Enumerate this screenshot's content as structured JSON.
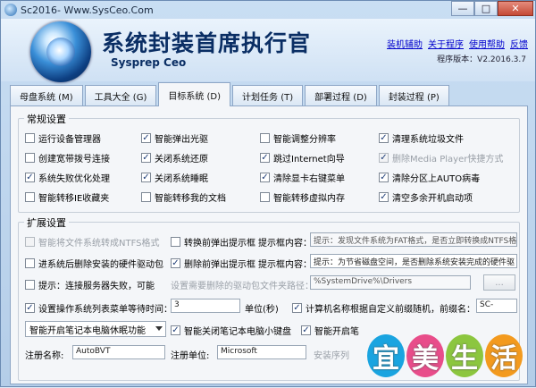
{
  "window": {
    "title": "Sc2016- Www.SysCeo.Com",
    "min": "—",
    "max": "□",
    "close": "✕"
  },
  "header": {
    "name": "系统封装首席执行官",
    "subtitle": "Sysprep Ceo",
    "links": [
      "装机辅助",
      "关于程序",
      "使用帮助",
      "反馈"
    ],
    "version": "程序版本：V2.2016.3.7"
  },
  "tabs": [
    {
      "label": "母盘系统 (M)"
    },
    {
      "label": "工具大全 (G)"
    },
    {
      "label": "目标系统 (D)"
    },
    {
      "label": "计划任务 (T)"
    },
    {
      "label": "部署过程 (D)"
    },
    {
      "label": "封装过程 (P)"
    }
  ],
  "active_tab": "目标系统 (D)",
  "general": {
    "title": "常规设置",
    "items": [
      {
        "label": "运行设备管理器",
        "checked": false
      },
      {
        "label": "智能弹出光驱",
        "checked": true
      },
      {
        "label": "智能调整分辨率",
        "checked": false
      },
      {
        "label": "清理系统垃圾文件",
        "checked": true
      },
      {
        "label": "创建宽带拨号连接",
        "checked": false
      },
      {
        "label": "关闭系统还原",
        "checked": true
      },
      {
        "label": "跳过Internet向导",
        "checked": true
      },
      {
        "label": "删除Media Player快捷方式",
        "checked": true,
        "disabled": true
      },
      {
        "label": "系统失败优化处理",
        "checked": true
      },
      {
        "label": "关闭系统睡眠",
        "checked": true
      },
      {
        "label": "清除显卡右键菜单",
        "checked": true
      },
      {
        "label": "清除分区上AUTO病毒",
        "checked": true
      },
      {
        "label": "智能转移IE收藏夹",
        "checked": false
      },
      {
        "label": "智能转移我的文档",
        "checked": false
      },
      {
        "label": "智能转移虚拟内存",
        "checked": false
      },
      {
        "label": "清空多余开机启动项",
        "checked": true
      }
    ]
  },
  "extended": {
    "title": "扩展设置",
    "ntfs": {
      "label": "智能将文件系统转成NTFS格式",
      "checked": false
    },
    "prompt1": {
      "label": "转换前弹出提示框",
      "checked": false
    },
    "prompt1_content_label": "提示框内容：",
    "prompt1_content": "提示：发现文件系统为FAT格式，是否立即转换成NTFS格",
    "remove_drivers": {
      "label": "进系统后删除安装的硬件驱动包",
      "checked": false
    },
    "prompt2": {
      "label": "删除前弹出提示框",
      "checked": true
    },
    "prompt2_content_label": "提示框内容：",
    "prompt2_content": "提示：为节省磁盘空间，是否删除系统安装完成的硬件驱",
    "server_fail": {
      "label": "提示：连接服务器失败，可能",
      "checked": false
    },
    "driver_path_label": "设置需要删除的驱动包文件夹路径：",
    "driver_path": "%SystemDrive%\\Drivers",
    "browse": "...",
    "wait": {
      "label": "设置操作系统列表菜单等待时间：",
      "checked": true
    },
    "wait_value": "3",
    "wait_unit": "单位(秒)",
    "computer_name": {
      "label": "计算机名称根据自定义前缀随机，前缀名：",
      "checked": true
    },
    "prefix_value": "SC-",
    "power_select": "智能开启笔记本电脑休眠功能",
    "close_keyboard": {
      "label": "智能关闭笔记本电脑小键盘",
      "checked": true
    },
    "open_kb": {
      "label": "智能开启笔",
      "checked": true
    },
    "reg_name_label": "注册名称:",
    "reg_name": "AutoBVT",
    "reg_unit_label": "注册单位:",
    "reg_unit": "Microsoft",
    "install_list_label": "安装序列"
  },
  "watermark": {
    "chars": [
      "宜",
      "美",
      "生",
      "活"
    ],
    "colors": [
      "#1aa4e0",
      "#e84d8a",
      "#8cc63f",
      "#f39a1e"
    ]
  }
}
